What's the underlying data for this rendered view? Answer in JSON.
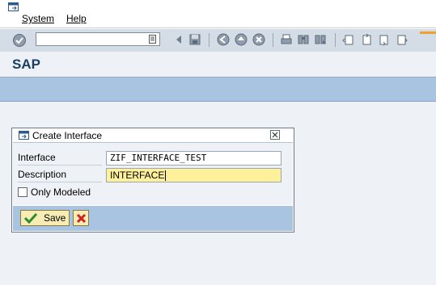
{
  "menu": {
    "system": "System",
    "help": "Help"
  },
  "toolbar": {
    "command_value": ""
  },
  "page": {
    "title": "SAP"
  },
  "dialog": {
    "title": "Create Interface",
    "interface_label": "Interface",
    "interface_value": "ZIF_INTERFACE_TEST",
    "description_label": "Description",
    "description_value": "INTERFACE",
    "only_modeled_label": "Only Modeled",
    "only_modeled_checked": false,
    "save_label": "Save"
  },
  "colors": {
    "app_bar": "#a8c4e0",
    "title_text": "#1c3f66",
    "active_field": "#fff09a",
    "button_bg": "#f6ecb4",
    "cancel_red": "#d02020",
    "save_green": "#2e8b2e"
  },
  "icons": [
    "app-menu-icon",
    "enter-icon",
    "history-dropdown-icon",
    "back-icon",
    "save-icon",
    "navigate-back-icon",
    "exit-icon",
    "cancel-icon",
    "print-icon",
    "find-icon",
    "find-next-icon",
    "first-page-icon",
    "previous-page-icon",
    "next-page-icon",
    "last-page-icon",
    "dialog-icon",
    "close-icon",
    "cancel-icon"
  ]
}
